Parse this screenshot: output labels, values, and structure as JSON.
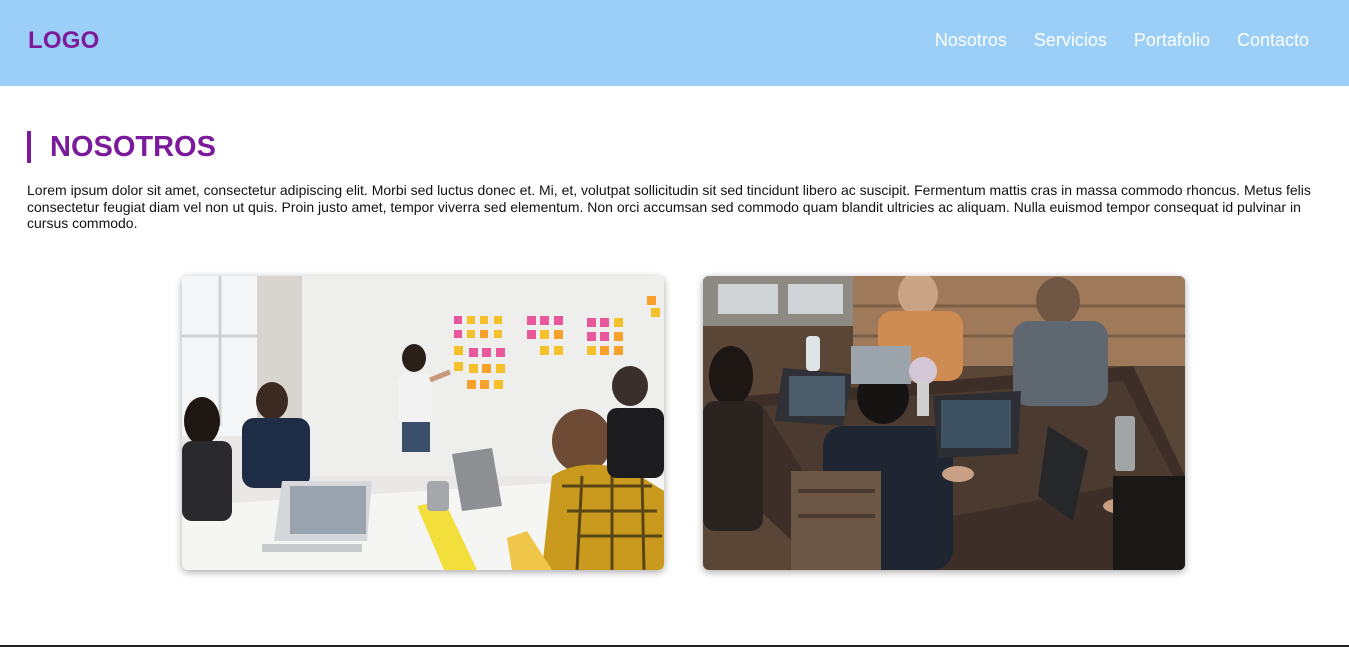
{
  "header": {
    "logo": "LOGO",
    "nav": [
      "Nosotros",
      "Servicios",
      "Portafolio",
      "Contacto"
    ]
  },
  "section": {
    "title": "NOSOTROS",
    "body": "Lorem ipsum dolor sit amet, consectetur adipiscing elit. Morbi sed luctus donec et. Mi, et, volutpat sollicitudin sit sed tincidunt libero ac suscipit. Fermentum mattis cras in massa commodo rhoncus. Metus felis consectetur feugiat diam vel non ut quis. Proin justo amet, tempor viverra sed elementum. Non orci accumsan sed commodo quam blandit ultricies ac aliquam. Nulla euismod tempor consequat id pulvinar in cursus commodo."
  },
  "colors": {
    "header_bg": "#9ccff8",
    "accent": "#7b1a9a",
    "nav_text": "#ffffff"
  }
}
